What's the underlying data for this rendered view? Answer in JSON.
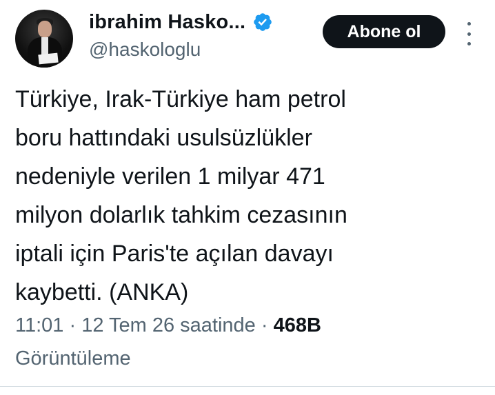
{
  "header": {
    "display_name": "ibrahim Hasko...",
    "handle": "@haskologlu",
    "follow_label": "Abone ol",
    "verified_color": "#1d9bf0"
  },
  "tweet": {
    "lines": [
      "Türkiye, Irak-Türkiye ham petrol",
      "boru hattındaki usulsüzlükler",
      "nedeniyle verilen 1 milyar 471",
      "milyon dolarlık tahkim cezasının",
      "iptali için Paris'te açılan davayı",
      "kaybetti.  (ANKA)"
    ]
  },
  "meta": {
    "time": "11:01",
    "date": "12 Tem 26 saatinde",
    "views_count": "468B",
    "views_label": "Görüntüleme"
  },
  "icons": {
    "avatar": "profile-photo",
    "verified": "verified-badge-icon",
    "more": "more-vertical-icon"
  }
}
